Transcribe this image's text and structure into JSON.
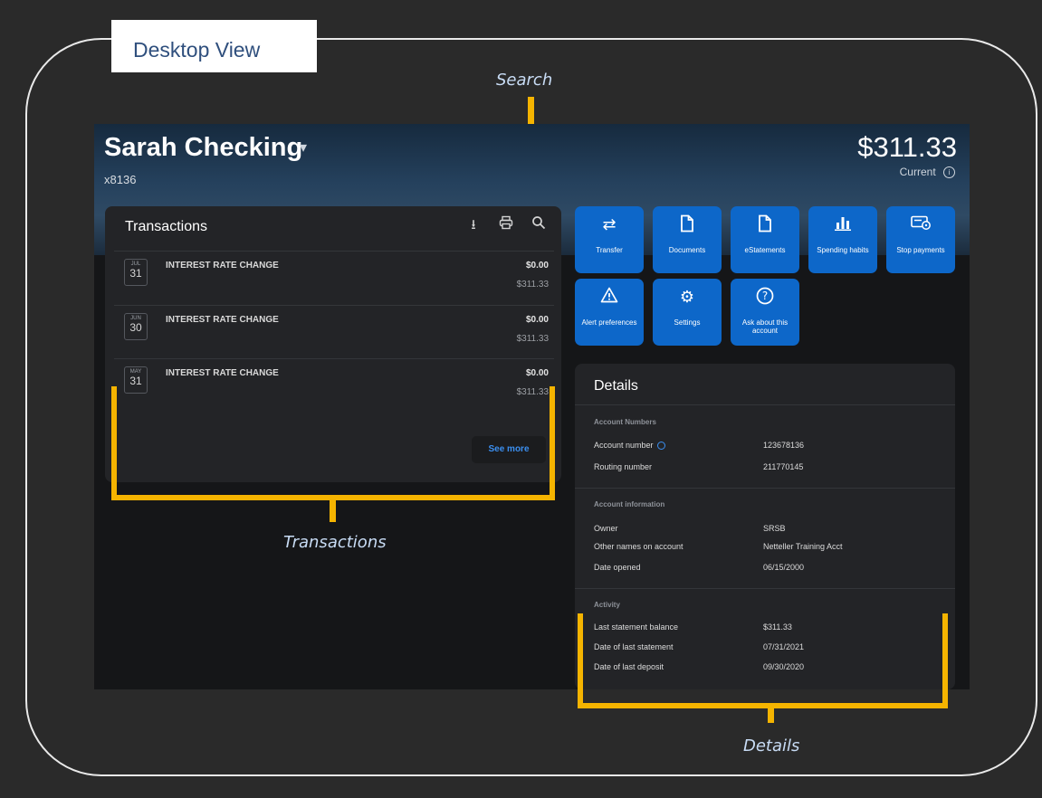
{
  "view_label": "Desktop View",
  "annotations": {
    "search": "Search",
    "transactions": "Transactions",
    "details": "Details"
  },
  "account": {
    "name": "Sarah Checking",
    "number": "x8136",
    "balance": "$311.33",
    "balance_status": "Current"
  },
  "transactions": {
    "title": "Transactions",
    "rows": [
      {
        "month": "JUL",
        "day": "31",
        "description": "INTEREST RATE CHANGE",
        "amount": "$0.00",
        "balance": "$311.33"
      },
      {
        "month": "JUN",
        "day": "30",
        "description": "INTEREST RATE CHANGE",
        "amount": "$0.00",
        "balance": "$311.33"
      },
      {
        "month": "MAY",
        "day": "31",
        "description": "INTEREST RATE CHANGE",
        "amount": "$0.00",
        "balance": "$311.33"
      }
    ],
    "see_more": "See more"
  },
  "actions": [
    {
      "label": "Transfer",
      "icon": "transfer-icon"
    },
    {
      "label": "Documents",
      "icon": "document-icon"
    },
    {
      "label": "eStatements",
      "icon": "document-icon"
    },
    {
      "label": "Spending habits",
      "icon": "bar-chart-icon"
    },
    {
      "label": "Stop payments",
      "icon": "stop-payment-icon"
    },
    {
      "label": "Alert preferences",
      "icon": "warning-icon"
    },
    {
      "label": "Settings",
      "icon": "gear-icon"
    },
    {
      "label": "Ask about this account",
      "icon": "question-icon"
    }
  ],
  "details": {
    "title": "Details",
    "account_numbers": {
      "heading": "Account Numbers",
      "account_number_label": "Account number",
      "account_number": "123678136",
      "routing_number_label": "Routing number",
      "routing_number": "211770145"
    },
    "account_information": {
      "heading": "Account information",
      "owner_label": "Owner",
      "owner": "SRSB",
      "other_names_label": "Other names on account",
      "other_names": "Netteller Training Acct",
      "date_opened_label": "Date opened",
      "date_opened": "06/15/2000"
    },
    "activity": {
      "heading": "Activity",
      "last_statement_balance_label": "Last statement balance",
      "last_statement_balance": "$311.33",
      "date_of_last_statement_label": "Date of last statement",
      "date_of_last_statement": "07/31/2021",
      "date_of_last_deposit_label": "Date of last deposit",
      "date_of_last_deposit": "09/30/2020"
    }
  },
  "colors": {
    "accent": "#f5b400",
    "tile_blue": "#0d67c9",
    "link_blue": "#3b8ff0"
  }
}
